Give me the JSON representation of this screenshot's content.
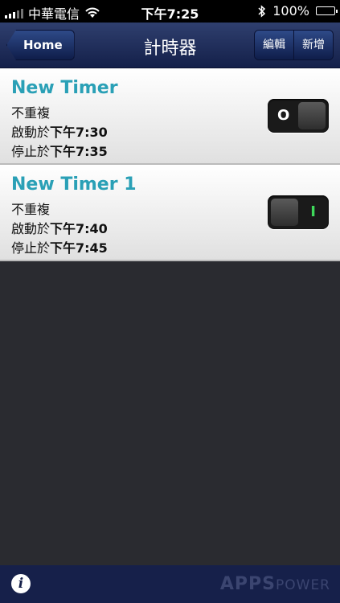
{
  "status": {
    "carrier": "中華電信",
    "time": "下午7:25",
    "battery": "100%"
  },
  "nav": {
    "back_label": "Home",
    "title": "計時器",
    "edit_label": "編輯",
    "add_label": "新增"
  },
  "timers": [
    {
      "name": "New Timer",
      "repeat": "不重複",
      "start_prefix": "啟動於",
      "start_time": "下午7:30",
      "stop_prefix": "停止於",
      "stop_time": "下午7:35",
      "switch_label": "O"
    },
    {
      "name": "New Timer 1",
      "repeat": "不重複",
      "start_prefix": "啟動於",
      "start_time": "下午7:40",
      "stop_prefix": "停止於",
      "stop_time": "下午7:45",
      "switch_label": "I"
    }
  ],
  "bottom": {
    "brand_main": "APPS",
    "brand_sub": "POWER",
    "info_glyph": "i"
  },
  "icons": {
    "wifi": "wifi-icon",
    "bluetooth": "bluetooth-icon",
    "battery": "battery-icon",
    "info": "info-icon"
  },
  "colors": {
    "accent": "#2aa0b6",
    "nav": "#14204a",
    "on": "#3ed85a"
  }
}
